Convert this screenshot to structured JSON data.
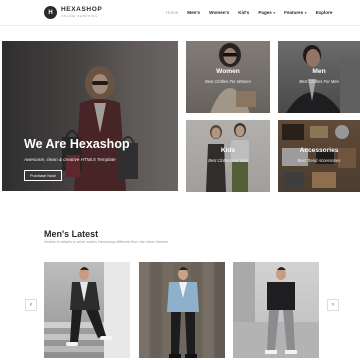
{
  "header": {
    "logo_mark": "H",
    "logo_name": "HEXASHOP",
    "logo_tagline": "ONLINE SHOPPING",
    "nav": [
      {
        "label": "Home",
        "active": true,
        "dropdown": false
      },
      {
        "label": "Men's",
        "active": false,
        "dropdown": false
      },
      {
        "label": "Women's",
        "active": false,
        "dropdown": false
      },
      {
        "label": "Kid's",
        "active": false,
        "dropdown": false
      },
      {
        "label": "Pages",
        "active": false,
        "dropdown": true
      },
      {
        "label": "Features",
        "active": false,
        "dropdown": true
      },
      {
        "label": "Explore",
        "active": false,
        "dropdown": false
      }
    ],
    "caret_glyph": "▾"
  },
  "hero": {
    "title": "We Are Hexashop",
    "subtitle": "Awesome, clean & creative HTML5 Template",
    "button_label": "Purchase Now!"
  },
  "categories": {
    "women": {
      "name": "Women",
      "subtitle": "Best Clothes For Women"
    },
    "men": {
      "name": "Men",
      "subtitle": "Best Clothes For Men"
    },
    "kids": {
      "name": "Kids",
      "subtitle": "Best Clothes For Kids"
    },
    "accessories": {
      "name": "Accessories",
      "subtitle": "Best Trend Accessories"
    }
  },
  "latest": {
    "title": "Men's Latest",
    "subtitle": "Details to details is what makes Hexashop different from the other themes."
  },
  "carousel": {
    "prev_glyph": "‹",
    "next_glyph": "›"
  },
  "colors": {
    "accent": "#2a2a2a",
    "muted": "#9a9a9a"
  }
}
